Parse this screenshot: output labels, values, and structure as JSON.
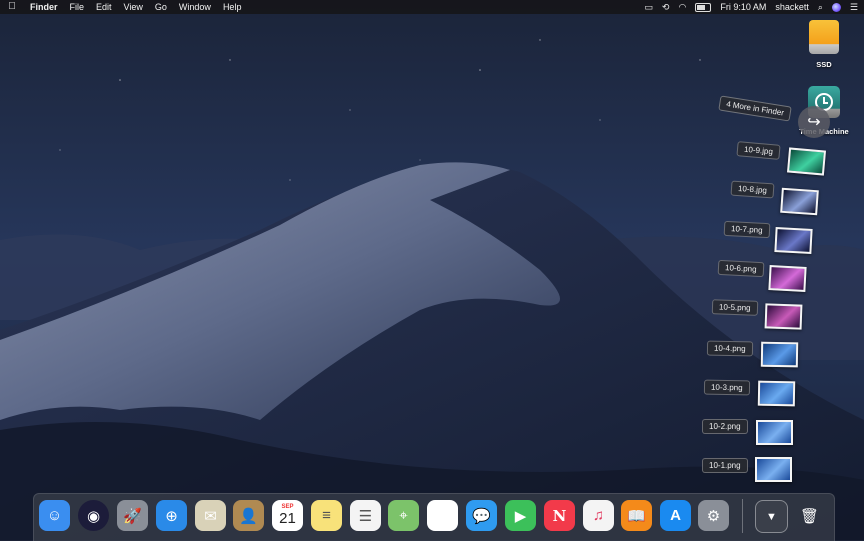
{
  "menubar": {
    "apple_icon": "apple-icon",
    "items": [
      {
        "label": "Finder",
        "bold": true
      },
      {
        "label": "File",
        "bold": false
      },
      {
        "label": "Edit",
        "bold": false
      },
      {
        "label": "View",
        "bold": false
      },
      {
        "label": "Go",
        "bold": false
      },
      {
        "label": "Window",
        "bold": false
      },
      {
        "label": "Help",
        "bold": false
      }
    ],
    "status": {
      "clock": "Fri 9:10 AM",
      "user": "shackett"
    }
  },
  "desktop": {
    "icons": [
      {
        "label": "SSD",
        "icon": "external-drive-icon"
      },
      {
        "label": "Time Machine",
        "icon": "time-machine-drive-icon"
      }
    ]
  },
  "stack": {
    "more_label": "4 More in Finder",
    "files": [
      {
        "label": "10-9.jpg",
        "thumb_colors": [
          "#0a4a3a",
          "#3fd0a0"
        ]
      },
      {
        "label": "10-8.jpg",
        "thumb_colors": [
          "#0b0f2a",
          "#8aa0d8"
        ]
      },
      {
        "label": "10-7.png",
        "thumb_colors": [
          "#0b1030",
          "#6a78c8"
        ]
      },
      {
        "label": "10-6.png",
        "thumb_colors": [
          "#3a0e4a",
          "#d46ad8"
        ]
      },
      {
        "label": "10-5.png",
        "thumb_colors": [
          "#2a0a3a",
          "#c85ab8"
        ]
      },
      {
        "label": "10-4.png",
        "thumb_colors": [
          "#103a7a",
          "#5a9ae8"
        ]
      },
      {
        "label": "10-3.png",
        "thumb_colors": [
          "#1a4a9a",
          "#6aaaf0"
        ]
      },
      {
        "label": "10-2.png",
        "thumb_colors": [
          "#1a4a9a",
          "#7ab0f0"
        ]
      },
      {
        "label": "10-1.png",
        "thumb_colors": [
          "#1a4a9a",
          "#7ab0f0"
        ]
      }
    ]
  },
  "dock": {
    "calendar_month": "SEP",
    "calendar_day": "21",
    "apps": [
      {
        "name": "finder",
        "icon": "finder-icon",
        "bg": "#3a8ef0",
        "glyph": "☺"
      },
      {
        "name": "siri",
        "icon": "siri-icon",
        "bg": "#1c1c3a",
        "glyph": "◉"
      },
      {
        "name": "launchpad",
        "icon": "launchpad-icon",
        "bg": "#8a8f98",
        "glyph": "🚀"
      },
      {
        "name": "safari",
        "icon": "safari-icon",
        "bg": "#2a8ae8",
        "glyph": "⊕"
      },
      {
        "name": "mail",
        "icon": "mail-icon",
        "bg": "#d9d2b8",
        "glyph": "✉"
      },
      {
        "name": "contacts",
        "icon": "contacts-icon",
        "bg": "#b08a52",
        "glyph": "👤"
      },
      {
        "name": "calendar",
        "icon": "calendar-icon",
        "bg": "#ffffff",
        "glyph": ""
      },
      {
        "name": "notes",
        "icon": "notes-icon",
        "bg": "#f8e27a",
        "glyph": "≡"
      },
      {
        "name": "reminders",
        "icon": "reminders-icon",
        "bg": "#f4f4f4",
        "glyph": "☰"
      },
      {
        "name": "maps",
        "icon": "maps-icon",
        "bg": "#7cc36a",
        "glyph": "⌖"
      },
      {
        "name": "photos",
        "icon": "photos-icon",
        "bg": "#ffffff",
        "glyph": "✿"
      },
      {
        "name": "messages",
        "icon": "messages-icon",
        "bg": "#2f9bf0",
        "glyph": "💬"
      },
      {
        "name": "facetime",
        "icon": "facetime-icon",
        "bg": "#3cc05a",
        "glyph": "▶"
      },
      {
        "name": "news",
        "icon": "news-icon",
        "bg": "#f23a4a",
        "glyph": "N"
      },
      {
        "name": "itunes",
        "icon": "itunes-icon",
        "bg": "#f4f4f4",
        "glyph": "♫"
      },
      {
        "name": "books",
        "icon": "books-icon",
        "bg": "#f48a1a",
        "glyph": "📖"
      },
      {
        "name": "app-store",
        "icon": "app-store-icon",
        "bg": "#1a8af0",
        "glyph": "A"
      },
      {
        "name": "system-preferences",
        "icon": "system-preferences-icon",
        "bg": "#8a8f98",
        "glyph": "⚙"
      },
      {
        "name": "downloads-stack",
        "icon": "downloads-stack-icon",
        "bg": "#3a3f4a",
        "glyph": "▼"
      },
      {
        "name": "trash",
        "icon": "trash-icon",
        "bg": "transparent",
        "glyph": "🗑"
      }
    ]
  }
}
